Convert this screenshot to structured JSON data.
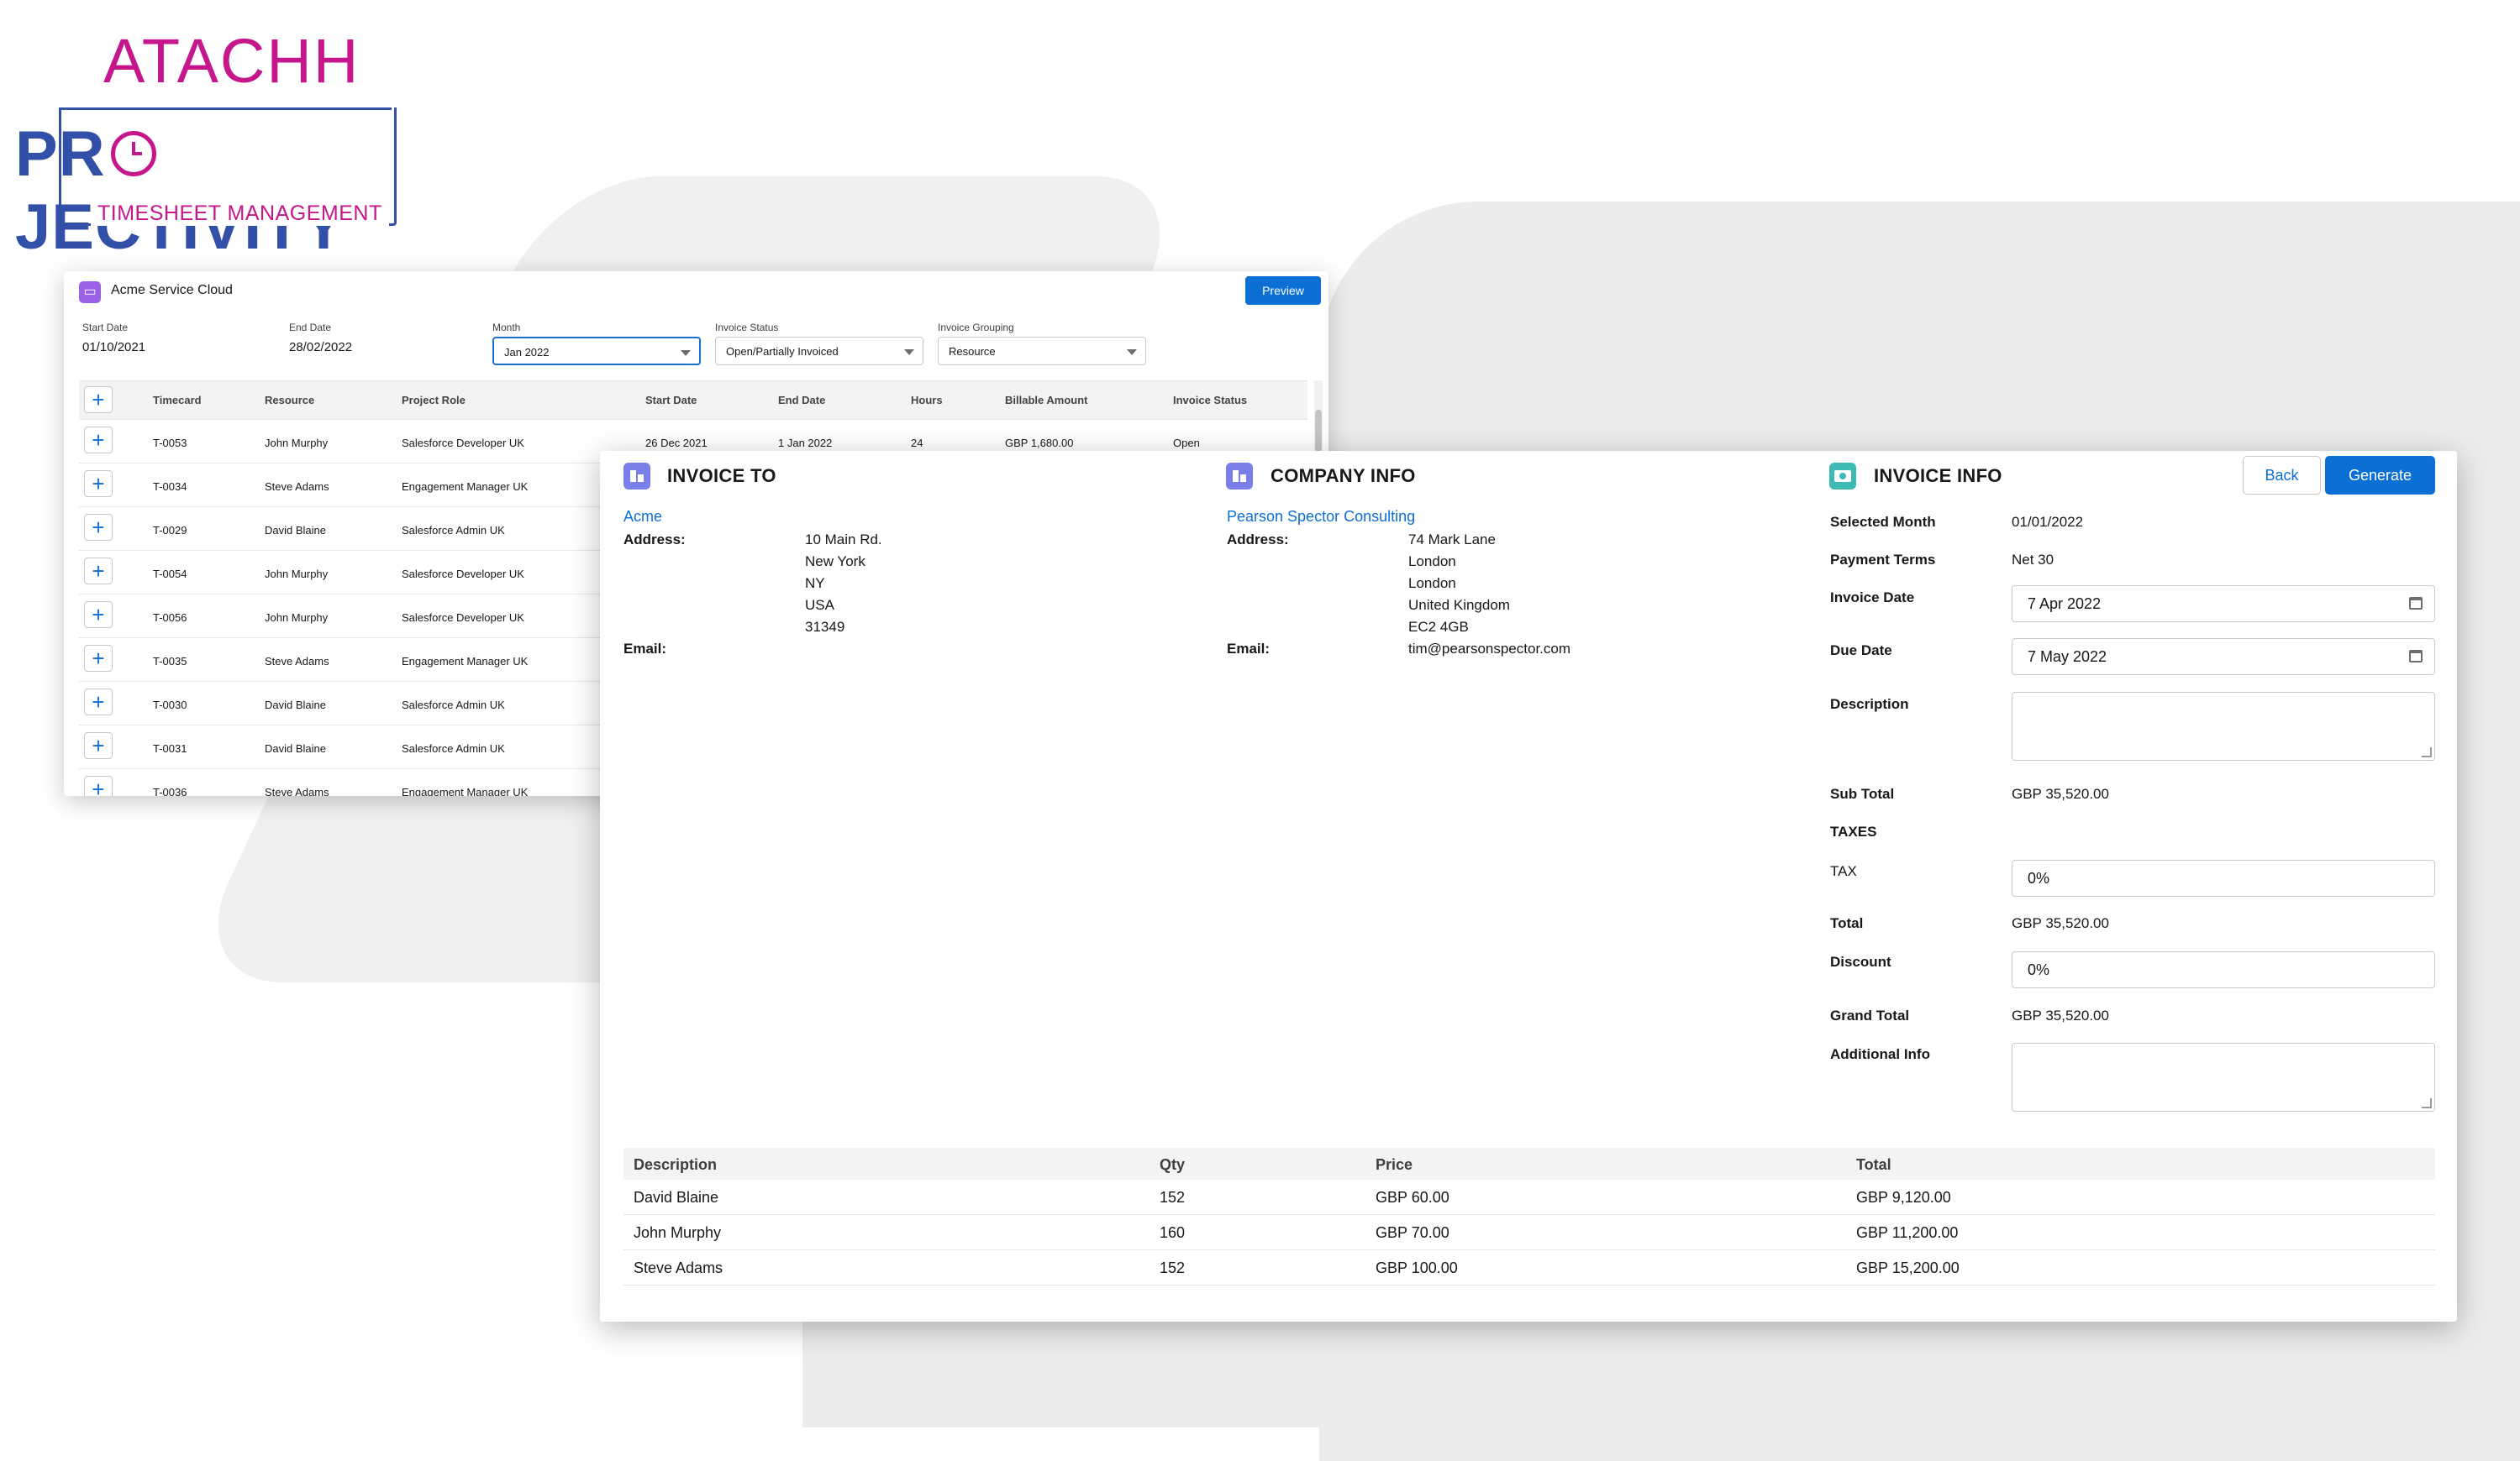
{
  "brand": {
    "company": "ATACHH",
    "product_pre": "PR",
    "product_post": "JECTIVITY",
    "tagline": "TIMESHEET MANAGEMENT"
  },
  "back_panel": {
    "title": "Acme Service Cloud",
    "preview_label": "Preview",
    "filters": {
      "start_date_label": "Start Date",
      "start_date": "01/10/2021",
      "end_date_label": "End Date",
      "end_date": "28/02/2022",
      "month_label": "Month",
      "month": "Jan 2022",
      "invoice_status_label": "Invoice Status",
      "invoice_status": "Open/Partially Invoiced",
      "invoice_grouping_label": "Invoice Grouping",
      "invoice_grouping": "Resource"
    },
    "columns": [
      "Timecard",
      "Resource",
      "Project Role",
      "Start Date",
      "End Date",
      "Hours",
      "Billable Amount",
      "Invoice Status"
    ],
    "rows": [
      {
        "timecard": "T-0053",
        "resource": "John Murphy",
        "role": "Salesforce Developer UK",
        "start": "26 Dec 2021",
        "end": "1 Jan 2022",
        "hours": "24",
        "amount": "GBP 1,680.00",
        "status": "Open"
      },
      {
        "timecard": "T-0034",
        "resource": "Steve Adams",
        "role": "Engagement Manager UK"
      },
      {
        "timecard": "T-0029",
        "resource": "David Blaine",
        "role": "Salesforce Admin UK"
      },
      {
        "timecard": "T-0054",
        "resource": "John Murphy",
        "role": "Salesforce Developer UK"
      },
      {
        "timecard": "T-0056",
        "resource": "John Murphy",
        "role": "Salesforce Developer UK"
      },
      {
        "timecard": "T-0035",
        "resource": "Steve Adams",
        "role": "Engagement Manager UK"
      },
      {
        "timecard": "T-0030",
        "resource": "David Blaine",
        "role": "Salesforce Admin UK"
      },
      {
        "timecard": "T-0031",
        "resource": "David Blaine",
        "role": "Salesforce Admin UK"
      },
      {
        "timecard": "T-0036",
        "resource": "Steve Adams",
        "role": "Engagement Manager UK"
      }
    ]
  },
  "invoice": {
    "invoice_to": {
      "title": "INVOICE TO",
      "name": "Acme",
      "address_label": "Address:",
      "address_lines": [
        "10 Main Rd.",
        "New York",
        "NY",
        "USA",
        "31349"
      ],
      "email_label": "Email:",
      "email": ""
    },
    "company_info": {
      "title": "COMPANY INFO",
      "name": "Pearson Spector Consulting",
      "address_label": "Address:",
      "address_lines": [
        "74 Mark Lane",
        "London",
        "London",
        "United Kingdom",
        "EC2 4GB"
      ],
      "email_label": "Email:",
      "email": "tim@pearsonspector.com"
    },
    "invoice_info": {
      "title": "INVOICE INFO",
      "back_label": "Back",
      "generate_label": "Generate",
      "selected_month_label": "Selected Month",
      "selected_month": "01/01/2022",
      "payment_terms_label": "Payment Terms",
      "payment_terms": "Net 30",
      "invoice_date_label": "Invoice Date",
      "invoice_date": "7 Apr 2022",
      "due_date_label": "Due Date",
      "due_date": "7 May 2022",
      "description_label": "Description",
      "sub_total_label": "Sub Total",
      "sub_total": "GBP 35,520.00",
      "taxes_label": "TAXES",
      "tax_label": "TAX",
      "tax": "0%",
      "total_label": "Total",
      "total": "GBP 35,520.00",
      "discount_label": "Discount",
      "discount": "0%",
      "grand_total_label": "Grand Total",
      "grand_total": "GBP 35,520.00",
      "additional_info_label": "Additional Info"
    },
    "line_items": {
      "columns": [
        "Description",
        "Qty",
        "Price",
        "Total"
      ],
      "rows": [
        {
          "description": "David Blaine",
          "qty": "152",
          "price": "GBP 60.00",
          "total": "GBP 9,120.00"
        },
        {
          "description": "John Murphy",
          "qty": "160",
          "price": "GBP 70.00",
          "total": "GBP 11,200.00"
        },
        {
          "description": "Steve Adams",
          "qty": "152",
          "price": "GBP 100.00",
          "total": "GBP 15,200.00"
        }
      ]
    }
  },
  "colors": {
    "brand_pink": "#c5168c",
    "brand_blue": "#3350a8",
    "primary": "#0b6fd4"
  }
}
